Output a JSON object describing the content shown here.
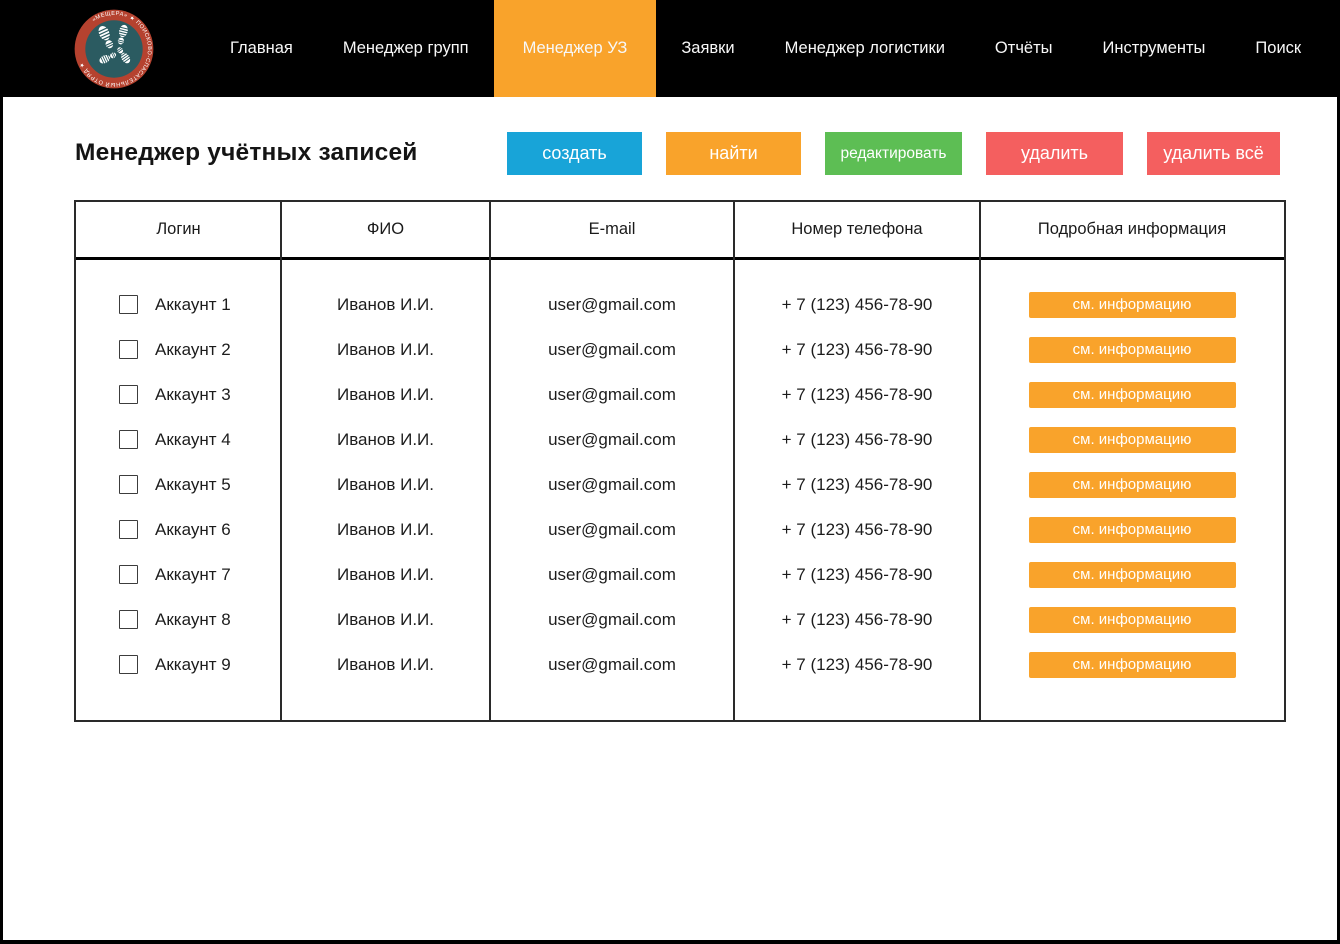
{
  "nav": {
    "logo": {
      "ring_text": "«МЕЩЕРА» ★ ПОИСКОВО-СПАСАТЕЛЬНЫЙ ОТРЯД ★"
    },
    "items": [
      {
        "label": "Главная",
        "active": false
      },
      {
        "label": "Менеджер групп",
        "active": false
      },
      {
        "label": "Менеджер УЗ",
        "active": true
      },
      {
        "label": "Заявки",
        "active": false
      },
      {
        "label": "Менеджер логистики",
        "active": false
      },
      {
        "label": "Отчёты",
        "active": false
      },
      {
        "label": "Инструменты",
        "active": false
      },
      {
        "label": "Поиск",
        "active": false
      }
    ]
  },
  "page": {
    "title": "Менеджер учётных записей"
  },
  "toolbar": {
    "create": "создать",
    "find": "найти",
    "edit": "редактировать",
    "delete": "удалить",
    "delete_all": "удалить всё"
  },
  "table": {
    "headers": [
      "Логин",
      "ФИО",
      "E-mail",
      "Номер телефона",
      "Подробная информация"
    ],
    "info_button_label": "см. информацию",
    "rows": [
      {
        "login": "Аккаунт 1",
        "name": "Иванов И.И.",
        "email": "user@gmail.com",
        "phone": "+ 7 (123) 456-78-90",
        "checked": false
      },
      {
        "login": "Аккаунт 2",
        "name": "Иванов И.И.",
        "email": "user@gmail.com",
        "phone": "+ 7 (123) 456-78-90",
        "checked": false
      },
      {
        "login": "Аккаунт 3",
        "name": "Иванов И.И.",
        "email": "user@gmail.com",
        "phone": "+ 7 (123) 456-78-90",
        "checked": false
      },
      {
        "login": "Аккаунт 4",
        "name": "Иванов И.И.",
        "email": "user@gmail.com",
        "phone": "+ 7 (123) 456-78-90",
        "checked": false
      },
      {
        "login": "Аккаунт 5",
        "name": "Иванов И.И.",
        "email": "user@gmail.com",
        "phone": "+ 7 (123) 456-78-90",
        "checked": false
      },
      {
        "login": "Аккаунт 6",
        "name": "Иванов И.И.",
        "email": "user@gmail.com",
        "phone": "+ 7 (123) 456-78-90",
        "checked": false
      },
      {
        "login": "Аккаунт 7",
        "name": "Иванов И.И.",
        "email": "user@gmail.com",
        "phone": "+ 7 (123) 456-78-90",
        "checked": false
      },
      {
        "login": "Аккаунт 8",
        "name": "Иванов И.И.",
        "email": "user@gmail.com",
        "phone": "+ 7 (123) 456-78-90",
        "checked": false
      },
      {
        "login": "Аккаунт 9",
        "name": "Иванов И.И.",
        "email": "user@gmail.com",
        "phone": "+ 7 (123) 456-78-90",
        "checked": false
      }
    ]
  },
  "colors": {
    "nav_bg": "#000000",
    "accent_orange": "#F9A32B",
    "accent_blue": "#18A4D8",
    "accent_green": "#5DBE54",
    "accent_red": "#F45F5F",
    "logo_ring": "#B5422F",
    "logo_center": "#2B5B61",
    "table_border": "#2a2a2a"
  }
}
